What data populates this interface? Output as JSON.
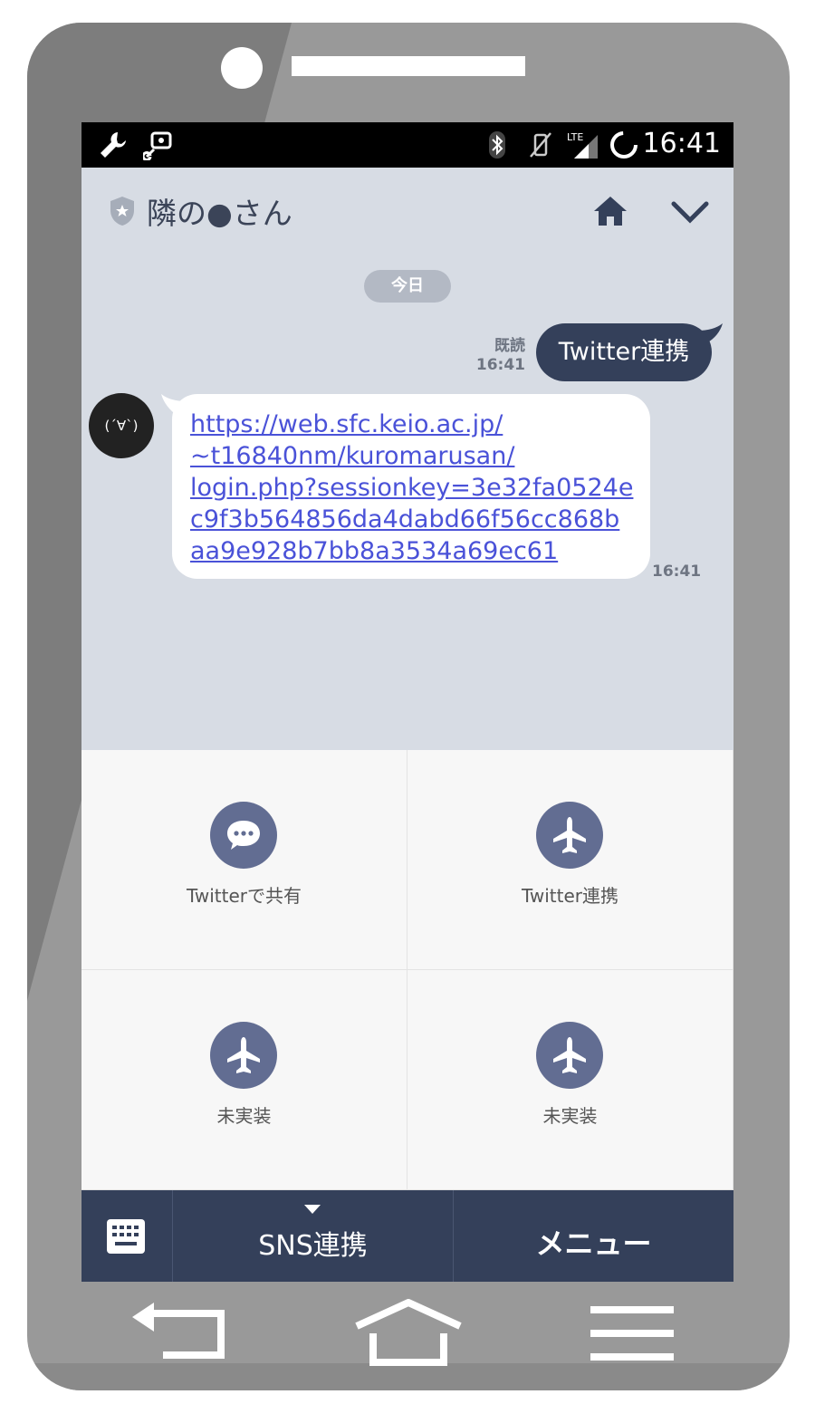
{
  "statusbar": {
    "time": "16:41",
    "icons": [
      "wrench-icon",
      "usb-debug-icon",
      "bluetooth-icon",
      "vibrate-off-icon",
      "lte-signal-icon",
      "loading-ring-icon"
    ],
    "network_label": "LTE"
  },
  "header": {
    "title": "隣の●さん",
    "icons": [
      "shield-star-icon",
      "home-icon",
      "chevron-down-icon"
    ]
  },
  "chat": {
    "date_label": "今日",
    "outgoing": {
      "read_label": "既読",
      "time": "16:41",
      "text": "Twitter連携"
    },
    "incoming": {
      "avatar_text": "(´∀`)",
      "link_lines": [
        "https://web.sfc.keio.ac.jp/",
        "~t16840nm/kuromarusan/",
        "login.php?sessionkey=3e32fa0524e",
        "c9f3b564856da4dabd66f56cc868b",
        "aa9e928b7bb8a3534a69ec61"
      ],
      "time": "16:41"
    }
  },
  "rich_menu": {
    "items": [
      {
        "label": "Twitterで共有",
        "icon": "chat-bubble-icon"
      },
      {
        "label": "Twitter連携",
        "icon": "airplane-icon"
      },
      {
        "label": "未実装",
        "icon": "airplane-icon"
      },
      {
        "label": "未実装",
        "icon": "airplane-icon"
      }
    ]
  },
  "bottom_bar": {
    "keyboard_icon": "keyboard-icon",
    "sns_label": "SNS連携",
    "menu_label": "メニュー"
  },
  "nav_bar": {
    "icons": [
      "back-icon",
      "home-outline-icon",
      "menu-lines-icon"
    ]
  },
  "colors": {
    "phone_body": "#999999",
    "chat_bg": "#d7dce4",
    "accent_navy": "#34405a",
    "icon_circle": "#626d92",
    "link": "#4a52d8"
  }
}
